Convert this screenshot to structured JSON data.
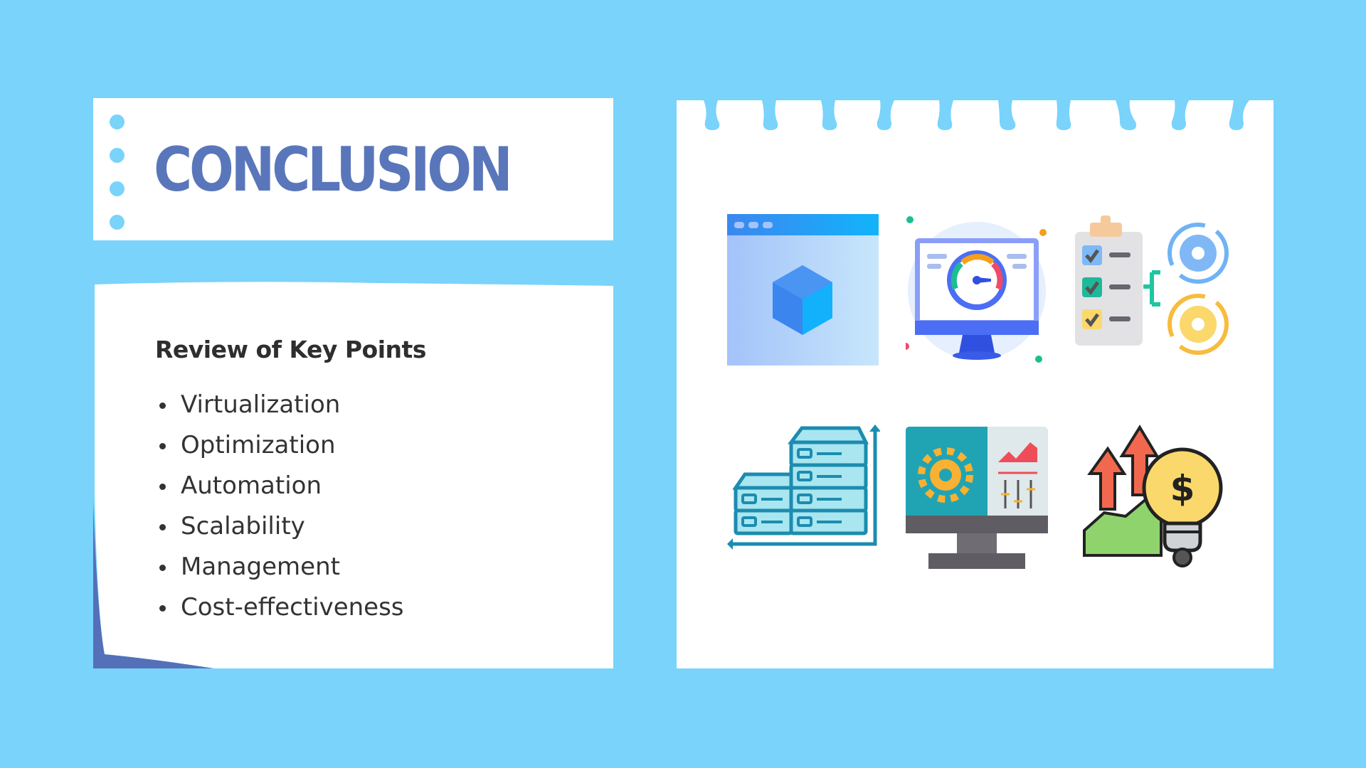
{
  "title_card": {
    "title": "CONCLUSION"
  },
  "body_card": {
    "heading": "Review of Key Points",
    "points": [
      "Virtualization",
      "Optimization",
      "Automation",
      "Scalability",
      "Management",
      "Cost-effectiveness"
    ]
  },
  "right_card": {
    "icons": [
      "virtual-cube-window-icon",
      "performance-gauge-monitor-icon",
      "checklist-gears-automation-icon",
      "scalable-servers-icon",
      "management-dashboard-monitor-icon",
      "cost-growth-lightbulb-icon"
    ]
  },
  "colors": {
    "background": "#79d3fb",
    "title": "#5a76bb",
    "text": "#333333",
    "accent_dark": "#5470b8"
  }
}
